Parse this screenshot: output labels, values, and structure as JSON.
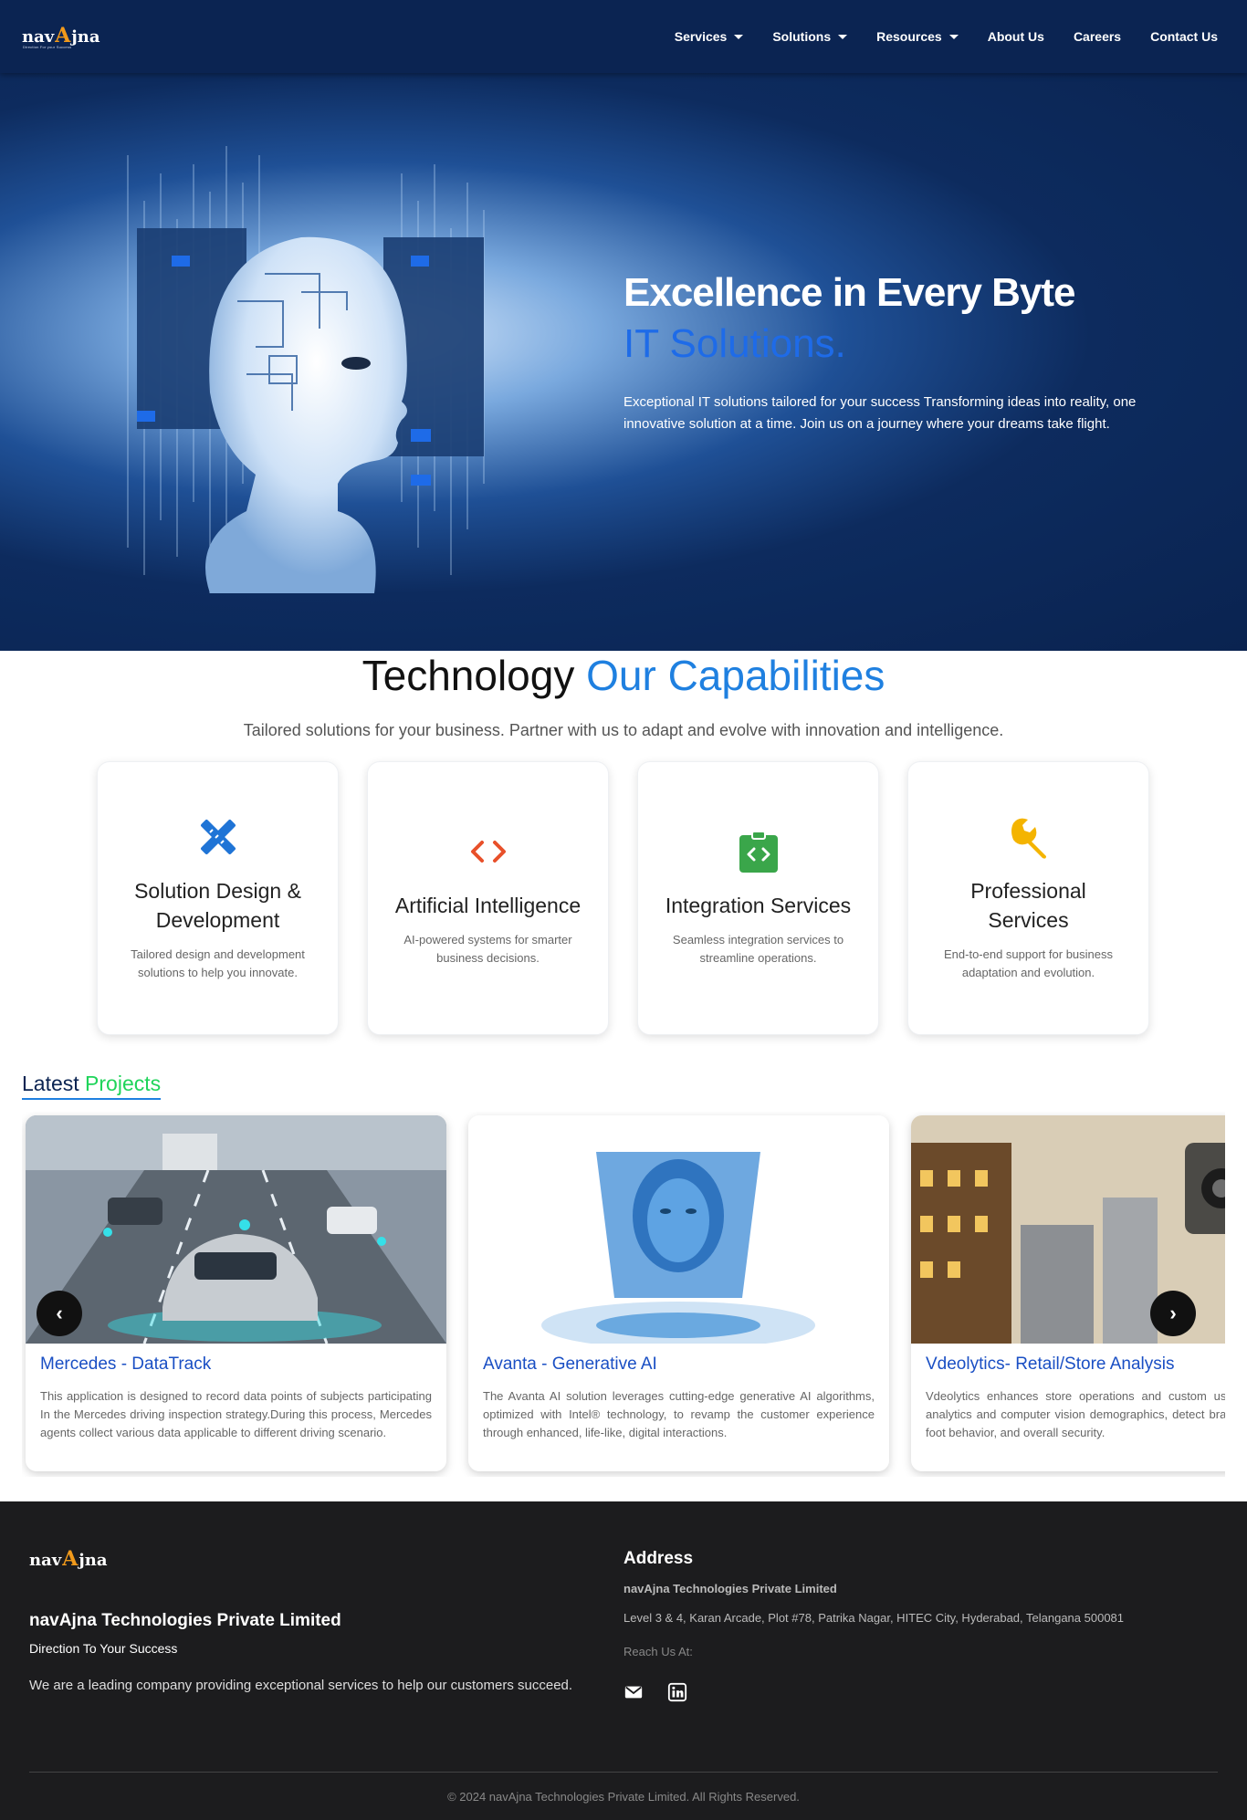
{
  "nav": {
    "logo_text_left": "nav",
    "logo_text_mark": "A",
    "logo_text_right": "jna",
    "logo_tagline": "Direction For your Success",
    "items": [
      {
        "label": "Services"
      },
      {
        "label": "Solutions"
      },
      {
        "label": "Resources"
      },
      {
        "label": "About Us"
      },
      {
        "label": "Careers"
      },
      {
        "label": "Contact Us"
      }
    ]
  },
  "hero": {
    "title": "Excellence in Every Byte",
    "subtitle": "IT Solutions.",
    "description": "Exceptional IT solutions tailored for your success Transforming ideas into reality, one innovative solution at a time. Join us on a journey where your dreams take flight."
  },
  "capabilities": {
    "title_dark": "Technology",
    "title_blue": "Our Capabilities",
    "description": "Tailored solutions for your business. Partner with us to adapt and evolve with innovation and intelligence.",
    "cards": [
      {
        "title": "Solution Design & Development",
        "text": "Tailored design and development solutions to help you innovate.",
        "icon": "design-tools-icon",
        "color": "#1f74d6"
      },
      {
        "title": "Artificial Intelligence",
        "text": "AI-powered systems for smarter business decisions.",
        "icon": "code-brackets-icon",
        "color": "#e8502a"
      },
      {
        "title": "Integration Services",
        "text": "Seamless integration services to streamline operations.",
        "icon": "code-clipboard-icon",
        "color": "#3aa64a"
      },
      {
        "title": "Professional Services",
        "text": "End-to-end support for business adaptation and evolution.",
        "icon": "wrench-icon",
        "color": "#f4b400"
      }
    ]
  },
  "projects": {
    "heading_dark": "Latest",
    "heading_green": "Projects",
    "items": [
      {
        "title": "Mercedes - DataTrack",
        "text": "This application is designed to record data points of subjects participating In the Mercedes driving inspection strategy.During this process, Mercedes agents collect various data applicable to different driving scenario."
      },
      {
        "title": "Avanta - Generative AI",
        "text": "The Avanta AI solution leverages cutting-edge generative AI algorithms, optimized with Intel® technology, to revamp the customer experience through enhanced, life-like, digital interactions."
      },
      {
        "title": "Vdeolytics- Retail/Store Analysis",
        "text": "Vdeolytics enhances store operations and custom using CCTV-based analytics and computer vision demographics, detect brands, and monitor foot behavior, and overall security."
      }
    ],
    "prev_label": "‹",
    "next_label": "›"
  },
  "footer": {
    "company": "navAjna Technologies Private Limited",
    "tagline": "Direction To Your Success",
    "about": "We are a leading company providing exceptional services to help our customers succeed.",
    "address_heading": "Address",
    "address_company": "navAjna Technologies Private Limited",
    "address": "Level 3 & 4, Karan Arcade, Plot #78, Patrika Nagar, HITEC City, Hyderabad, Telangana 500081",
    "reach_label": "Reach Us At:",
    "copyright": "© 2024 navAjna Technologies Private Limited. All Rights Reserved."
  },
  "colors": {
    "nav_bg": "#0b2452",
    "accent_blue": "#1f80e0",
    "accent_green": "#1fd45a",
    "footer_bg": "#1c1c1e"
  }
}
